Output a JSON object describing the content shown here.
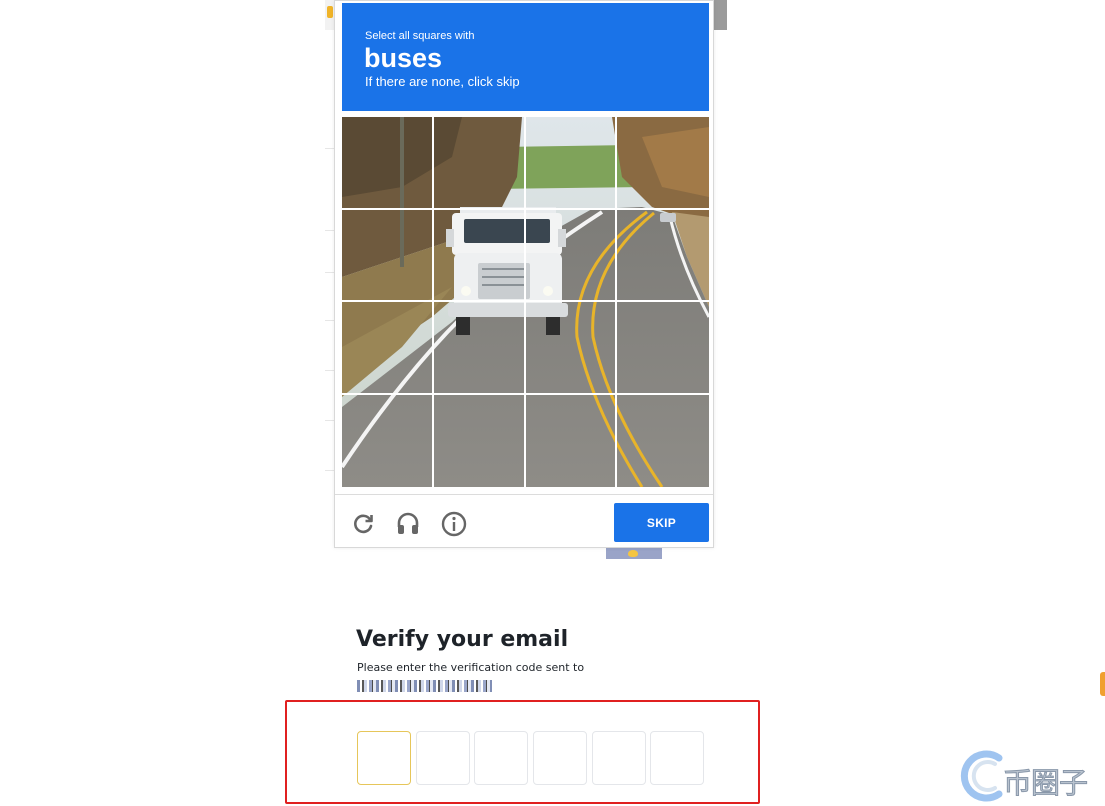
{
  "captcha": {
    "instruction_small": "Select all squares with",
    "instruction_target": "buses",
    "instruction_sub": "If there are none, click skip",
    "header_color": "#1a73e8",
    "grid_rows": 4,
    "grid_cols": 4,
    "controls": {
      "reload_icon": "reload-icon",
      "audio_icon": "headphones-icon",
      "info_icon": "info-icon"
    },
    "skip_label": "SKIP"
  },
  "verify": {
    "title": "Verify your email",
    "description": "Please enter the verification code sent to",
    "code_length": 6,
    "highlight_color": "#e02020",
    "active_field_color": "#e6c65a"
  },
  "watermark": {
    "text": "币圈子",
    "icon": "coin-logo-icon"
  }
}
